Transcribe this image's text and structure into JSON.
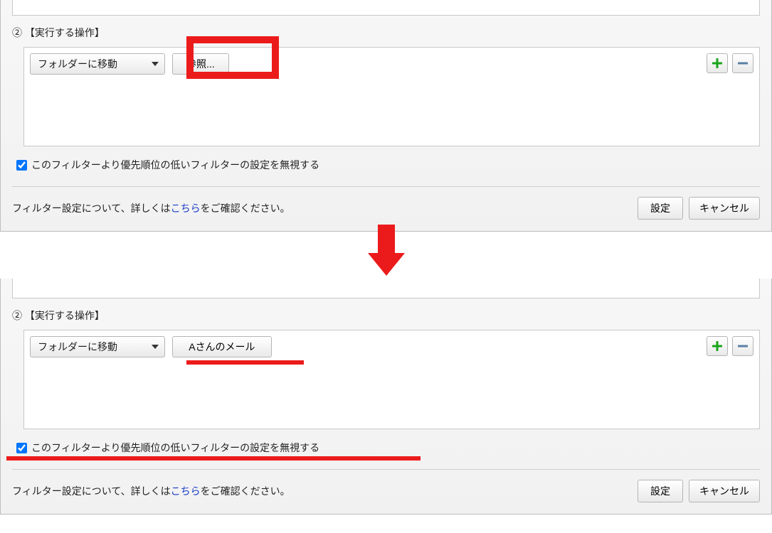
{
  "section": {
    "number": "②",
    "label": "【実行する操作】"
  },
  "action": {
    "select_value": "フォルダーに移動",
    "browse_btn": "参照...",
    "folder_btn": "Aさんのメール"
  },
  "checkbox": {
    "label": "このフィルターより優先順位の低いフィルターの設定を無視する"
  },
  "footer": {
    "text_before": "フィルター設定について、詳しくは",
    "link": "こちら",
    "text_after": "をご確認ください。"
  },
  "buttons": {
    "set": "設定",
    "cancel": "キャンセル"
  }
}
